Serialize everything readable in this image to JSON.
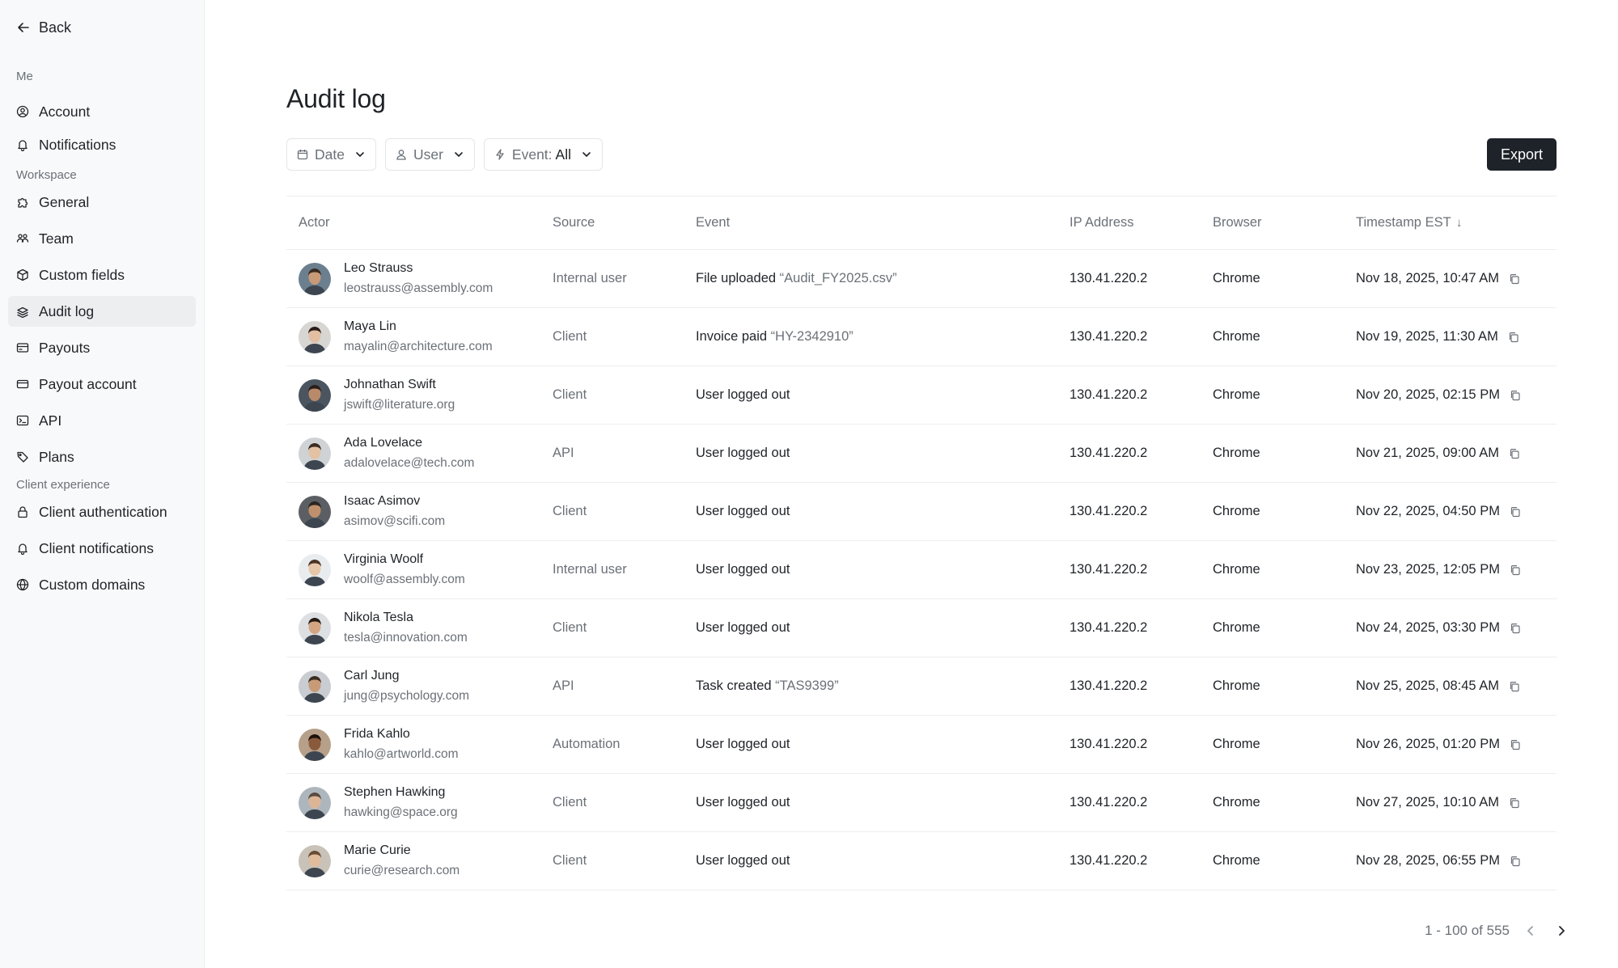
{
  "sidebar": {
    "back_label": "Back",
    "me_label": "Me",
    "me_items": [
      {
        "label": "Account",
        "icon": "user-circle-icon"
      },
      {
        "label": "Notifications",
        "icon": "bell-icon"
      }
    ],
    "workspace_label": "Workspace",
    "workspace_items": [
      {
        "label": "General",
        "icon": "puzzle-icon"
      },
      {
        "label": "Team",
        "icon": "team-icon"
      },
      {
        "label": "Custom fields",
        "icon": "cube-icon"
      },
      {
        "label": "Audit log",
        "icon": "stack-icon",
        "active": true
      },
      {
        "label": "Payouts",
        "icon": "payouts-icon"
      },
      {
        "label": "Payout account",
        "icon": "card-icon"
      },
      {
        "label": "API",
        "icon": "terminal-icon"
      },
      {
        "label": "Plans",
        "icon": "tag-icon"
      }
    ],
    "client_label": "Client experience",
    "client_items": [
      {
        "label": "Client authentication",
        "icon": "lock-icon"
      },
      {
        "label": "Client notifications",
        "icon": "bell-icon"
      },
      {
        "label": "Custom domains",
        "icon": "globe-icon"
      }
    ]
  },
  "page": {
    "title": "Audit log",
    "filters": {
      "date_label": "Date",
      "user_label": "User",
      "event_label": "Event:",
      "event_value": "All"
    },
    "export_label": "Export"
  },
  "table": {
    "headers": {
      "actor": "Actor",
      "source": "Source",
      "event": "Event",
      "ip": "IP Address",
      "browser": "Browser",
      "timestamp": "Timestamp EST",
      "sort_arrow": "↓"
    },
    "rows": [
      {
        "name": "Leo Strauss",
        "email": "leostrauss@assembly.com",
        "source": "Internal user",
        "event": "File uploaded",
        "event_detail": "“Audit_FY2025.csv”",
        "ip": "130.41.220.2",
        "browser": "Chrome",
        "timestamp": "Nov 18, 2025, 10:47 AM",
        "avatar": {
          "skin": "#c99a78",
          "hair": "#3a2a20",
          "bg": "#6b7f8f"
        }
      },
      {
        "name": "Maya Lin",
        "email": "mayalin@architecture.com",
        "source": "Client",
        "event": "Invoice paid",
        "event_detail": "“HY-2342910”",
        "ip": "130.41.220.2",
        "browser": "Chrome",
        "timestamp": "Nov 19, 2025, 11:30 AM",
        "avatar": {
          "skin": "#e2bfa3",
          "hair": "#2b1d16",
          "bg": "#d8d6d2"
        }
      },
      {
        "name": "Johnathan Swift",
        "email": "jswift@literature.org",
        "source": "Client",
        "event": "User logged out",
        "event_detail": "",
        "ip": "130.41.220.2",
        "browser": "Chrome",
        "timestamp": "Nov 20, 2025, 02:15 PM",
        "avatar": {
          "skin": "#b98a6a",
          "hair": "#2a1e18",
          "bg": "#4a5560"
        }
      },
      {
        "name": "Ada Lovelace",
        "email": "adalovelace@tech.com",
        "source": "API",
        "event": "User logged out",
        "event_detail": "",
        "ip": "130.41.220.2",
        "browser": "Chrome",
        "timestamp": "Nov 21, 2025, 09:00 AM",
        "avatar": {
          "skin": "#e3c2a4",
          "hair": "#3b2b22",
          "bg": "#cfd3d6"
        }
      },
      {
        "name": "Isaac Asimov",
        "email": "asimov@scifi.com",
        "source": "Client",
        "event": "User logged out",
        "event_detail": "",
        "ip": "130.41.220.2",
        "browser": "Chrome",
        "timestamp": "Nov 22, 2025, 04:50 PM",
        "avatar": {
          "skin": "#c0906c",
          "hair": "#2c2420",
          "bg": "#5b5f63"
        }
      },
      {
        "name": "Virginia Woolf",
        "email": "woolf@assembly.com",
        "source": "Internal user",
        "event": "User logged out",
        "event_detail": "",
        "ip": "130.41.220.2",
        "browser": "Chrome",
        "timestamp": "Nov 23, 2025, 12:05 PM",
        "avatar": {
          "skin": "#e6c7aa",
          "hair": "#4a3426",
          "bg": "#e9ecef"
        }
      },
      {
        "name": "Nikola Tesla",
        "email": "tesla@innovation.com",
        "source": "Client",
        "event": "User logged out",
        "event_detail": "",
        "ip": "130.41.220.2",
        "browser": "Chrome",
        "timestamp": "Nov 24, 2025, 03:30 PM",
        "avatar": {
          "skin": "#d4a582",
          "hair": "#241a14",
          "bg": "#dde0e3"
        }
      },
      {
        "name": "Carl Jung",
        "email": "jung@psychology.com",
        "source": "API",
        "event": "Task created",
        "event_detail": "“TAS9399”",
        "ip": "130.41.220.2",
        "browser": "Chrome",
        "timestamp": "Nov 25, 2025, 08:45 AM",
        "avatar": {
          "skin": "#c79a78",
          "hair": "#3a2c22",
          "bg": "#c9ccd0"
        }
      },
      {
        "name": "Frida Kahlo",
        "email": "kahlo@artworld.com",
        "source": "Automation",
        "event": "User logged out",
        "event_detail": "",
        "ip": "130.41.220.2",
        "browser": "Chrome",
        "timestamp": "Nov 26, 2025, 01:20 PM",
        "avatar": {
          "skin": "#8a5a3c",
          "hair": "#1c120c",
          "bg": "#b7a089"
        }
      },
      {
        "name": "Stephen Hawking",
        "email": "hawking@space.org",
        "source": "Client",
        "event": "User logged out",
        "event_detail": "",
        "ip": "130.41.220.2",
        "browser": "Chrome",
        "timestamp": "Nov 27, 2025, 10:10 AM",
        "avatar": {
          "skin": "#dcb596",
          "hair": "#5a4a3e",
          "bg": "#aeb6bd"
        }
      },
      {
        "name": "Marie Curie",
        "email": "curie@research.com",
        "source": "Client",
        "event": "User logged out",
        "event_detail": "",
        "ip": "130.41.220.2",
        "browser": "Chrome",
        "timestamp": "Nov 28, 2025, 06:55 PM",
        "avatar": {
          "skin": "#e0bc9c",
          "hair": "#6a4a34",
          "bg": "#c8c2b8"
        }
      }
    ]
  },
  "pagination": {
    "range": "1 - 100 of 555"
  }
}
